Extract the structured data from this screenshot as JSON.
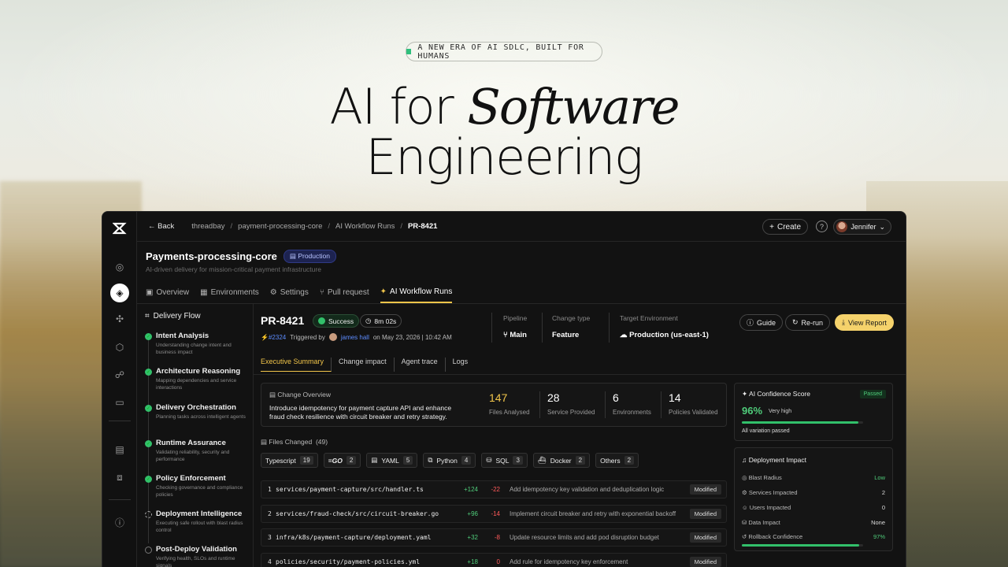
{
  "hero": {
    "pill": "A NEW ERA OF AI SDLC, BUILT FOR HUMANS",
    "line1_a": "AI for ",
    "line1_b": "Software",
    "line2": "Engineering"
  },
  "topbar": {
    "back": "Back",
    "breadcrumbs": [
      "threadbay",
      "payment-processing-core",
      "AI Workflow Runs",
      "PR-8421"
    ],
    "create": "Create",
    "user": "Jennifer"
  },
  "project": {
    "name": "Payments-processing-core",
    "env_badge": "Production",
    "subtitle": "AI-driven delivery for mission-critical payment infrastructure"
  },
  "tabs": [
    "Overview",
    "Environments",
    "Settings",
    "Pull request",
    "AI Workflow Runs"
  ],
  "flow": {
    "title": "Delivery Flow",
    "steps": [
      {
        "title": "Intent Analysis",
        "desc": "Understanding change intent and business impact"
      },
      {
        "title": "Architecture Reasoning",
        "desc": "Mapping dependencies and service interactions"
      },
      {
        "title": "Delivery Orchestration",
        "desc": "Planning tasks across intelligent agents"
      },
      {
        "title": "Runtime Assurance",
        "desc": "Validating reliability, security and performance"
      },
      {
        "title": "Policy Enforcement",
        "desc": "Checking governance and compliance policies"
      },
      {
        "title": "Deployment Intelligence",
        "desc": "Executing safe rollout with blast radius control"
      },
      {
        "title": "Post-Deploy Validation",
        "desc": "Verifying health, SLOs and runtime signals"
      }
    ]
  },
  "run": {
    "id": "PR-8421",
    "status": "Success",
    "duration": "8m 02s",
    "pr_ref": "#2324",
    "triggered_by_label": "Triggered by",
    "user": "james hall",
    "date": "on May 23, 2026 | 10:42 AM",
    "pipeline_label": "Pipeline",
    "pipeline": "Main",
    "change_type_label": "Change type",
    "change_type": "Feature",
    "target_env_label": "Target Environment",
    "target_env": "Production (us-east-1)"
  },
  "actions": {
    "guide": "Guide",
    "rerun": "Re-run",
    "report": "View Report"
  },
  "subtabs": [
    "Executive Summary",
    "Change impact",
    "Agent trace",
    "Logs"
  ],
  "overview": {
    "title": "Change Overview",
    "text": "Introduce idempotency for payment capture API and enhance fraud check resilience with circuit breaker and retry strategy.",
    "stats": [
      {
        "value": "147",
        "label": "Files Analysed"
      },
      {
        "value": "28",
        "label": "Service Provided"
      },
      {
        "value": "6",
        "label": "Environments"
      },
      {
        "value": "14",
        "label": "Policies Validated"
      }
    ]
  },
  "files": {
    "title": "Files Changed",
    "count": "(49)",
    "chips": [
      {
        "label": "Typescript",
        "count": "19"
      },
      {
        "label": "GO",
        "count": "2"
      },
      {
        "label": "YAML",
        "count": "5"
      },
      {
        "label": "Python",
        "count": "4"
      },
      {
        "label": "SQL",
        "count": "3"
      },
      {
        "label": "Docker",
        "count": "2"
      },
      {
        "label": "Others",
        "count": "2"
      }
    ],
    "rows": [
      {
        "n": "1",
        "path": "services/payment-capture/src/handler.ts",
        "add": "+124",
        "del": "-22",
        "desc": "Add idempotency key validation and deduplication logic",
        "tag": "Modified"
      },
      {
        "n": "2",
        "path": "services/fraud-check/src/circuit-breaker.go",
        "add": "+96",
        "del": "-14",
        "desc": "Implement circuit breaker and retry with exponential backoff",
        "tag": "Modified"
      },
      {
        "n": "3",
        "path": "infra/k8s/payment-capture/deployment.yaml",
        "add": "+32",
        "del": "-8",
        "desc": "Update resource limits and add pod disruption budget",
        "tag": "Modified"
      },
      {
        "n": "4",
        "path": "policies/security/payment-policies.yml",
        "add": "+18",
        "del": "0",
        "desc": "Add rule for idempotency key enforcement",
        "tag": "Modified"
      }
    ]
  },
  "confidence": {
    "title": "AI Confidence Score",
    "status": "Passed",
    "value": "96%",
    "sub": "Very high",
    "fill": 0.96,
    "foot": "All variation passed"
  },
  "impact": {
    "title": "Deployment Impact",
    "rows": [
      {
        "label": "Blast Radius",
        "value": "Low"
      },
      {
        "label": "Services Impacted",
        "value": "2"
      },
      {
        "label": "Users Impacted",
        "value": "0"
      },
      {
        "label": "Data Impact",
        "value": "None"
      },
      {
        "label": "Rollback Confidence",
        "value": "97%"
      }
    ],
    "rollback_fill": 0.97
  },
  "colors": {
    "accent": "#f1c54a",
    "success": "#32c06a",
    "primary_button": "#f5d26b"
  }
}
